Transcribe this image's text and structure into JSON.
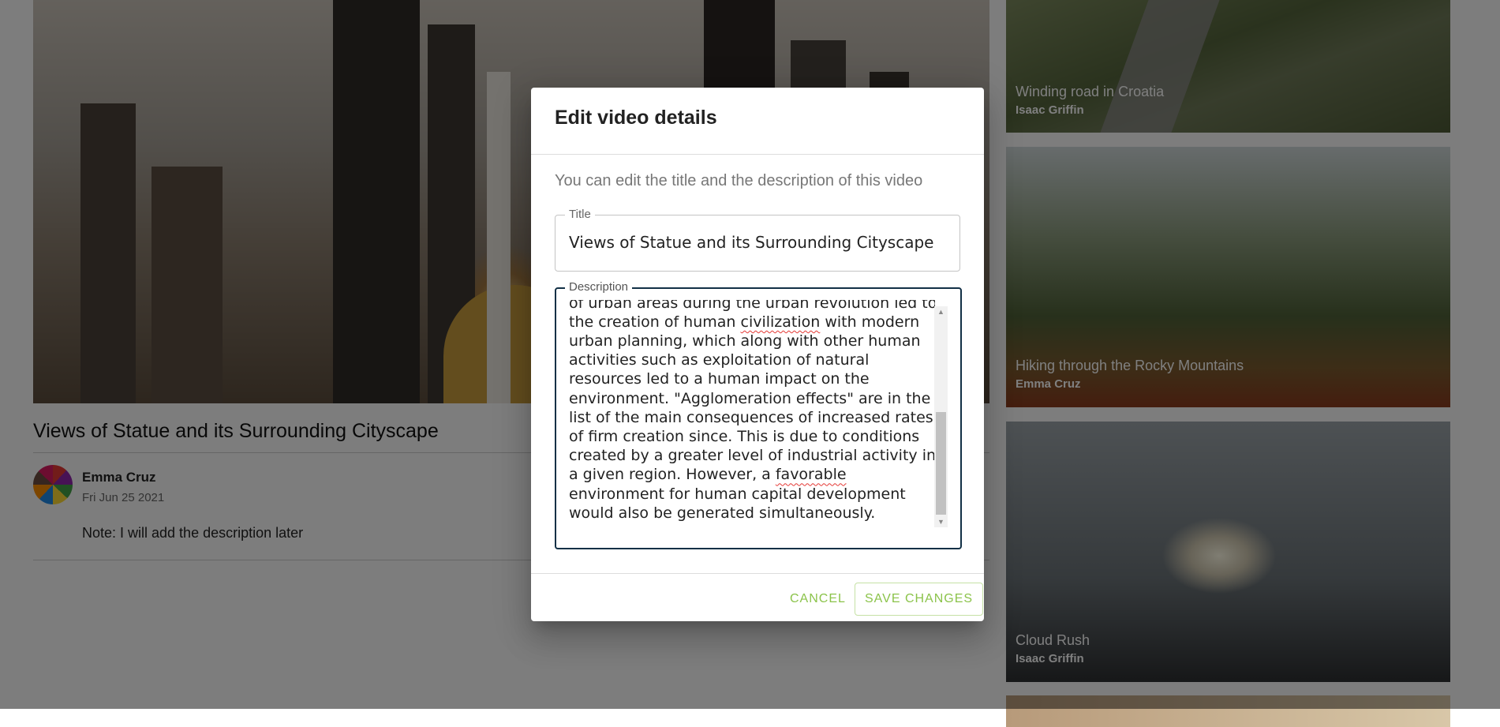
{
  "main_video": {
    "title": "Views of Statue and its Surrounding Cityscape",
    "author": "Emma Cruz",
    "date": "Fri Jun 25 2021",
    "note": "Note: I will add the description later"
  },
  "sidebar_videos": [
    {
      "title": "Winding road in Croatia",
      "author": "Isaac Griffin"
    },
    {
      "title": "Hiking through the Rocky Mountains",
      "author": "Emma Cruz"
    },
    {
      "title": "Cloud Rush",
      "author": "Isaac Griffin"
    }
  ],
  "dialog": {
    "title": "Edit video details",
    "subtitle": "You can edit the title and the description of this video",
    "title_field": {
      "label": "Title",
      "value": "Views of Statue and its Surrounding Cityscape"
    },
    "description_field": {
      "label": "Description",
      "visible_lines": [
        "of urban areas during the urban revolution led to",
        "the creation of human civilization with modern",
        "urban planning, which along with other human",
        "activities such as exploitation of natural",
        "resources led to a human impact on the",
        "environment. \"Agglomeration effects\" are in the",
        "list of the main consequences of increased rates",
        "of firm creation since. This is due to conditions",
        "created by a greater level of industrial activity in",
        "a given region. However, a favorable",
        "environment for human capital development",
        "would also be generated simultaneously."
      ],
      "misspelled_words": [
        "civilization",
        "favorable"
      ]
    },
    "cancel_label": "CANCEL",
    "save_label": "SAVE CHANGES"
  },
  "colors": {
    "accent": "#8bc34a",
    "focus_border": "#123046",
    "overlay": "rgba(0,0,0,0.5)"
  }
}
